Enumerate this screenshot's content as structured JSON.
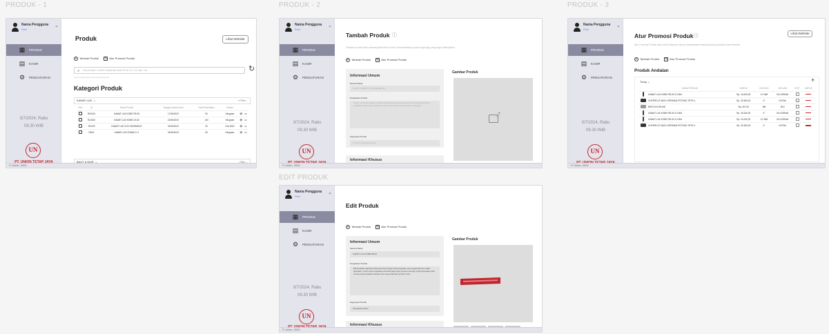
{
  "boards": {
    "produk1": "PRODUK - 1",
    "produk2": "PRODUK - 2",
    "produk3": "PRODUK - 3",
    "edit": "EDIT PRODUK"
  },
  "sidebar": {
    "user_name": "Nama Pengguna",
    "user_role": "Role",
    "nav_produk": "PRODUK",
    "nav_kasir": "KASIR",
    "nav_pengaturan": "PENGATURAN",
    "date": "3/7/2024, Rabu",
    "time": "09.30 WIB",
    "logo_text": "UN",
    "company": "PT. UNION TETAP JAYA"
  },
  "statusbar": {
    "text": "Union, 2024"
  },
  "produk1": {
    "title": "Produk",
    "website_button": "Lihat Website",
    "tab_add": "Tambah Produk",
    "tab_promo": "Atur Promosi Produk",
    "search_placeholder": "Cari produk / contoh: kawat las kobe Rl 26 2.6 / 3.2 dan / dll",
    "search_hint": "Cari produk pada nama barang dan ID",
    "section_title": "Kategori Produk",
    "group1": "KAWAT LAS",
    "group1_filter": "Filter",
    "group2": "BAUT & MUR",
    "group2_filter": "Filter",
    "table_headers": [
      "Pilih",
      "ID",
      "Nama Produk",
      "Tanggal masuk/ubah",
      "Stok/Persediaan",
      "Satuan",
      "",
      ""
    ],
    "rows": [
      {
        "id": "RK0001",
        "name": "KAWAT LAS KOBE RB 26",
        "date": "17/06/2023",
        "stock": "50",
        "unit": "Kilogram",
        "actions": "•••"
      },
      {
        "id": "RL0002",
        "name": "KAWAT LAS KOBE LB 52",
        "date": "21/06/2023",
        "stock": "140",
        "unit": "Kilogram",
        "actions": "•••"
      },
      {
        "id": "RC003",
        "name": "KAWAT LAS CO2 GEMINI/ELE",
        "date": "02/06/2023",
        "stock": "20",
        "unit": "GULUNG",
        "actions": "•••"
      },
      {
        "id": "RD01",
        "name": "KAWAT LAS ZONHE D 1",
        "date": "24/06/2023",
        "stock": "60",
        "unit": "Kilogram",
        "actions": "•••"
      }
    ]
  },
  "produk2": {
    "title": "Tambah Produk",
    "subtitle": "Tambah produk akan menampilkan form untuk menambahkan produk apa saja yang ingin ditampilkan.",
    "tab_add": "Tambah Produk",
    "tab_promo": "Atur Promosi Produk",
    "info_title": "Informasi Umum",
    "name_label": "Nama Produk",
    "name_placeholder": "Contoh: KAWAT LAS KOBE RB 26",
    "desc_label": "Penjelasan Produk",
    "desc_placeholder": "Contoh: Ini produk unggulan dengan kualitas tinggi yang sangat cocok untuk berbagai kebutuhan pengelasan Anda. Tulis penjelasan produk secara detail sesuai kebutuhan pelanggan.",
    "keyword_label": "Kegunaan Produk",
    "keyword_placeholder": "Contoh: Pengelasan besi",
    "special_title": "Informasi Khusus",
    "image_title": "Gambar Produk"
  },
  "produk3": {
    "title": "Atur Promosi Produk",
    "subtitle": "Atur Promosi Produk ada untuk halaman utama menyediakan barang barang andalan dari tersebut",
    "website_button": "Lihat Website",
    "tab_add": "Tambah Produk",
    "tab_promo": "Atur Promosi Produk",
    "section_title": "Produk Andalan",
    "filter_label": "Tutup",
    "headers": [
      "",
      "NAMA PRODUK",
      "HARGA",
      "UKURAN",
      "SATUAN",
      "EDIT",
      "HAPUS"
    ],
    "rows": [
      {
        "name": "KAWAT LAS KOBE RB 26 3.2 MM",
        "price": "Rp. 34.430,00",
        "size": "3.2 MM",
        "unit": "KILOGRAM"
      },
      {
        "name": "SUPERCUT BATU GERINDA POTONG TIPIS 4",
        "price": "Rp. 32.350,00",
        "size": "4\"",
        "unit": "KOTAK"
      },
      {
        "name": "BESI NYLON M8",
        "price": "Rp. 307,00",
        "size": "M8",
        "unit": "BIJI"
      },
      {
        "name": "KAWAT LAS KOBE RB 26 4.0 MM",
        "price": "Rp. 28.160,00",
        "size": "4\"",
        "unit": "KILOGRAM"
      },
      {
        "name": "KAWAT LAS KOBE RB 26 3.2 MM",
        "price": "Rp. 34.430,00",
        "size": "3.2 MM",
        "unit": "KILOGRAM"
      },
      {
        "name": "SUPERCUT BATU GERINDA POTONG TIPIS 4",
        "price": "Rp. 32.350,00",
        "size": "4\"",
        "unit": "KOTAK"
      }
    ]
  },
  "edit": {
    "title": "Edit Produk",
    "tab_add": "Tambah Produk",
    "tab_promo": "Atur Promosi Produk",
    "info_title": "Informasi Umum",
    "name_label": "Nama Produk",
    "name_value": "KAWAT LAS KOBE RB 26",
    "desc_label": "Penjelasan Produk",
    "desc_value": "RB 26 adalah elektroda terbaik dari Kobe dengan hasil pengelasan yang sangat baik dan mudah digunakan. Cocok untuk pengelasan konstruksi baja ringan sampai menengah. Dapat digunakan pada semua posisi pengelasan dengan busur yang stabil dan percikan minim.",
    "keyword_label": "Kegunaan Produk",
    "keyword_value": "Pengelasan Besi",
    "special_title": "Informasi Khusus",
    "image_title": "Gambar Produk"
  }
}
